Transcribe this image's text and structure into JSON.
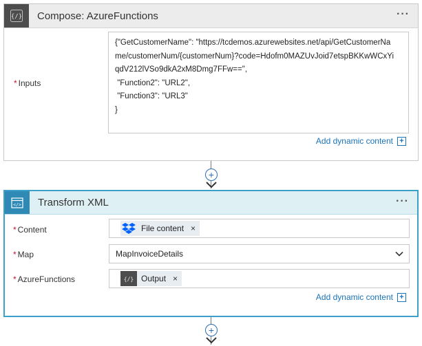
{
  "compose_card": {
    "title": "Compose: AzureFunctions",
    "menu_label": "···",
    "inputs_label": "Inputs",
    "required_mark": "*",
    "inputs_lines": [
      "{\"GetCustomerName\": \"https://tcdemos.azurewebsites.net/api/GetCustomerNa",
      "me/customerNum/{customerNum}?code=Hdofm0MAZUvJoid7etspBKKwWCxYi",
      "qdV212lVSo9dkA2xM8Dmg7FFw==\",",
      " \"Function2\": \"URL2\",",
      " \"Function3\": \"URL3\"",
      "}"
    ],
    "dynamic_content_label": "Add dynamic content",
    "icon": "braces-icon"
  },
  "connector": {
    "plus": "+"
  },
  "transform_card": {
    "title": "Transform XML",
    "menu_label": "···",
    "icon": "xml-transform-icon",
    "content_label": "Content",
    "content_token": {
      "label": "File content",
      "icon": "dropbox-icon",
      "remove": "×"
    },
    "map_label": "Map",
    "map_value": "MapInvoiceDetails",
    "azure_label": "AzureFunctions",
    "azure_token": {
      "label": "Output",
      "icon": "braces-icon",
      "remove": "×"
    },
    "dynamic_content_label": "Add dynamic content",
    "required_mark": "*"
  },
  "colors": {
    "accent_blue": "#2e8ab5",
    "link_blue": "#1a73b8",
    "dropbox_blue": "#0061fe",
    "required_red": "#c8102e"
  }
}
